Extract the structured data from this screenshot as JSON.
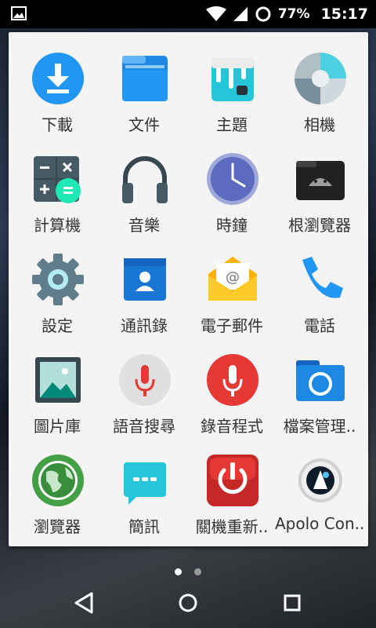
{
  "status_bar": {
    "battery_percent": "77%",
    "time": "15:17",
    "icons": [
      "image-notification-icon",
      "wifi-icon",
      "cell-signal-icon",
      "sync-circle-icon"
    ]
  },
  "apps": [
    {
      "label": "下載",
      "icon": "download-icon"
    },
    {
      "label": "文件",
      "icon": "files-folder-icon"
    },
    {
      "label": "主題",
      "icon": "themes-icon"
    },
    {
      "label": "相機",
      "icon": "camera-icon"
    },
    {
      "label": "計算機",
      "icon": "calculator-icon"
    },
    {
      "label": "音樂",
      "icon": "music-headphones-icon"
    },
    {
      "label": "時鐘",
      "icon": "clock-icon"
    },
    {
      "label": "根瀏覽器",
      "icon": "root-browser-icon"
    },
    {
      "label": "設定",
      "icon": "settings-gear-icon"
    },
    {
      "label": "通訊錄",
      "icon": "contacts-icon"
    },
    {
      "label": "電子郵件",
      "icon": "email-icon"
    },
    {
      "label": "電話",
      "icon": "phone-icon"
    },
    {
      "label": "圖片庫",
      "icon": "gallery-icon"
    },
    {
      "label": "語音搜尋",
      "icon": "voice-search-icon"
    },
    {
      "label": "錄音程式",
      "icon": "sound-recorder-icon"
    },
    {
      "label": "檔案管理..",
      "icon": "file-manager-icon"
    },
    {
      "label": "瀏覽器",
      "icon": "browser-globe-icon"
    },
    {
      "label": "簡訊",
      "icon": "messaging-icon"
    },
    {
      "label": "關機重新..",
      "icon": "power-reboot-icon"
    },
    {
      "label": "Apolo Con..",
      "icon": "apollo-emblem-icon"
    }
  ],
  "pager": {
    "pages": 2,
    "active_page": 1
  },
  "nav": {
    "buttons": [
      "back-icon",
      "home-icon",
      "recents-icon"
    ]
  },
  "colors": {
    "active_dot": "#ffffff",
    "inactive_dot": "#9a9a9a",
    "drawer_bg": "#f4f4f4"
  }
}
